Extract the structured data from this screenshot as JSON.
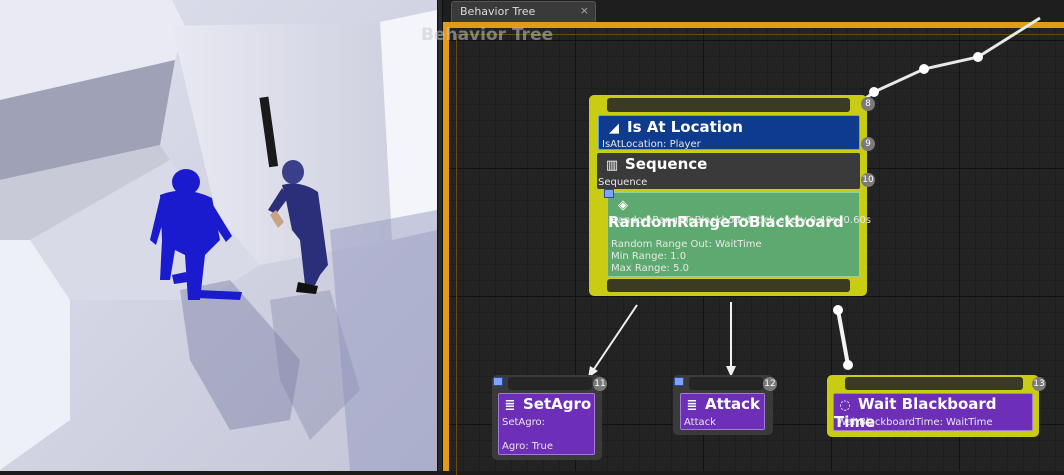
{
  "tab": {
    "label": "Behavior Tree",
    "close": "×"
  },
  "graph": {
    "title": "Behavior Tree"
  },
  "root_node": {
    "index": "8"
  },
  "decorator": {
    "title": "Is At Location",
    "subtitle": "IsAtLocation: Player",
    "index": "9",
    "icon": "location-icon",
    "color": "#0f3b8e"
  },
  "composite": {
    "title": "Sequence",
    "subtitle": "Sequence",
    "index": "10",
    "icon": "sequence-icon"
  },
  "service": {
    "title": "RandomRangeToBlackboard",
    "lines": [
      "RandomRangeToBlackboard: tick every 0.40s..0.60s",
      "",
      "Random Range Out: WaitTime",
      "Min Range: 1.0",
      "Max Range: 5.0"
    ],
    "icon": "service-icon",
    "color": "#5ea96f"
  },
  "tasks": [
    {
      "title": "SetAgro",
      "lines": [
        "SetAgro:",
        "",
        "Agro: True"
      ],
      "index": "11",
      "icon": "task-icon",
      "selected": false
    },
    {
      "title": "Attack",
      "lines": [
        "Attack"
      ],
      "index": "12",
      "icon": "task-icon",
      "selected": false
    },
    {
      "title": "Wait Blackboard Time",
      "lines": [
        "WaitBlackboardTime: WaitTime"
      ],
      "index": "13",
      "icon": "wait-icon",
      "selected": true
    }
  ],
  "colors": {
    "selection": "#c8cc12",
    "task": "#6e2fb8",
    "frame": "#e39a14"
  }
}
